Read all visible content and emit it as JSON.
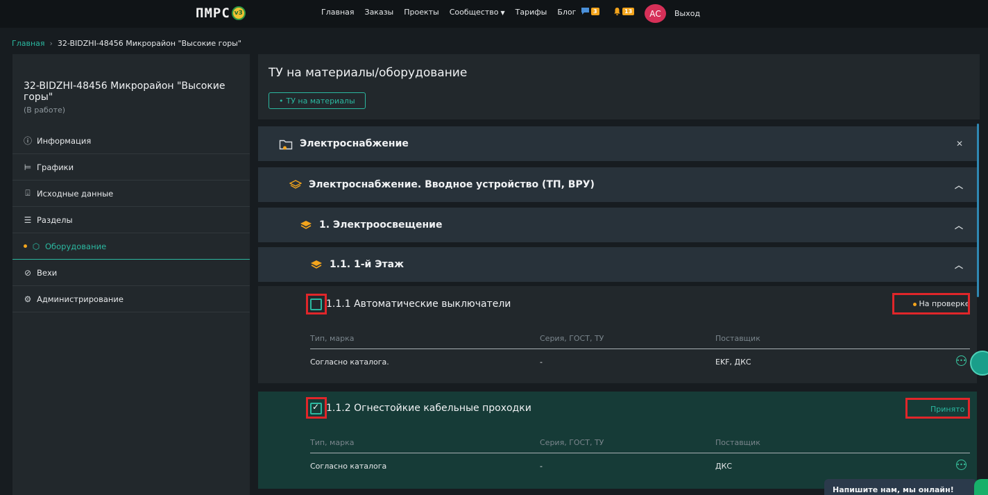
{
  "topbar": {
    "logo": "ПМРС",
    "logo_version": "v3",
    "nav": [
      "Главная",
      "Заказы",
      "Проекты",
      "Сообщество",
      "Тарифы",
      "Блог"
    ],
    "messages_count": "3",
    "notifications_count": "13",
    "avatar_initials": "АС",
    "logout": "Выход"
  },
  "breadcrumb": {
    "home": "Главная",
    "separator": "›",
    "current": "32-BIDZHI-48456 Микрорайон \"Высокие горы\""
  },
  "sidebar": {
    "project_title": "32-BIDZHI-48456 Микрорайон \"Высокие горы\"",
    "project_status": "(В работе)",
    "items": [
      {
        "label": "Информация",
        "icon": "info-icon"
      },
      {
        "label": "Графики",
        "icon": "chart-icon"
      },
      {
        "label": "Исходные данные",
        "icon": "download-icon"
      },
      {
        "label": "Разделы",
        "icon": "sections-icon"
      },
      {
        "label": "Оборудование",
        "icon": "box-icon",
        "active": true
      },
      {
        "label": "Вехи",
        "icon": "check-circle-icon"
      },
      {
        "label": "Администрирование",
        "icon": "gear-icon"
      }
    ]
  },
  "main": {
    "title": "ТУ на материалы/оборудование",
    "tag": "ТУ на материалы",
    "section": "Электроснабжение",
    "subsection": "Электроснабжение. Вводное устройство (ТП, ВРУ)",
    "group": "1. Электроосвещение",
    "subgroup": "1.1. 1-й Этаж",
    "columns": [
      "Тип, марка",
      "Серия, ГОСТ, ТУ",
      "Поставщик"
    ],
    "items": [
      {
        "title": "1.1.1 Автоматические выключатели",
        "status": "На проверке",
        "checked": false,
        "cells": [
          "Согласно каталога.",
          "-",
          "EKF, ДКС"
        ]
      },
      {
        "title": "1.1.2 Огнестойкие кабельные проходки",
        "status": "Принято",
        "checked": true,
        "cells": [
          "Согласно каталога",
          "-",
          "ДКС"
        ]
      }
    ]
  },
  "chat": {
    "label": "Напишите нам, мы онлайн!"
  },
  "colors": {
    "accent": "#2bb8a0",
    "warning": "#f4a51c",
    "highlight": "#e0262a",
    "avatar": "#d63058"
  }
}
